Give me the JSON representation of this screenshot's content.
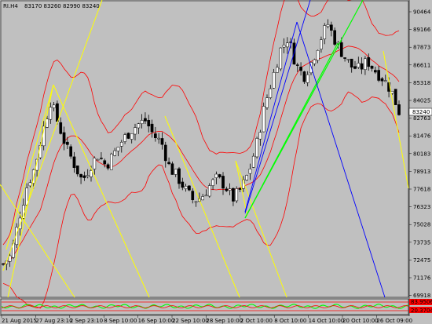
{
  "header": {
    "symbol_tf": "RI.H4",
    "ohlc": "83170 83260 82990 83240"
  },
  "price_axis": {
    "ticks": [
      "90464",
      "89166",
      "87873",
      "86611",
      "85318",
      "84025",
      "82763",
      "81476",
      "80183",
      "78913",
      "77618",
      "76323",
      "75028",
      "73735",
      "72475",
      "71176",
      "69918"
    ],
    "last_price": "83240",
    "last_price_color": "#000000"
  },
  "indicator_axis": {
    "upper": "83.9506",
    "lower": "20.3704",
    "upper_color": "#ff0000",
    "lower_color": "#ff0000"
  },
  "time_axis": {
    "ticks": [
      "21 Aug 2015",
      "27 Aug 23:10",
      "2 Sep 23:10",
      "8 Sep 10:00",
      "16 Sep 10:00",
      "22 Sep 10:00",
      "28 Sep 10:00",
      "2 Oct 10:00",
      "8 Oct 10:00",
      "14 Oct 10:00",
      "20 Oct 10:00",
      "26 Oct 09:00"
    ]
  },
  "colors": {
    "background": "#c0c0c0",
    "bull": "#ffffff",
    "bear": "#000000",
    "bollinger": "#ff0000",
    "fib_fan": "#ffff00",
    "trend_up": "#00ff00",
    "trend_blue": "#0000ff",
    "indicator_green": "#00ff00",
    "indicator_red": "#ff0000"
  },
  "chart_data": {
    "type": "candlestick",
    "close_path": [
      72200,
      72800,
      75500,
      77800,
      79200,
      81800,
      84000,
      82300,
      80600,
      79400,
      78200,
      79300,
      80100,
      79300,
      80200,
      81100,
      81800,
      82300,
      82600,
      81500,
      81000,
      79200,
      78500,
      77600,
      76800,
      77000,
      77800,
      78400,
      77900,
      76900,
      77600,
      78800,
      80800,
      83600,
      85600,
      87700,
      88600,
      86600,
      85800,
      86900,
      88400,
      89600,
      88300,
      87300,
      86500,
      86300,
      86900,
      86200,
      85600,
      84800,
      83240
    ]
  }
}
